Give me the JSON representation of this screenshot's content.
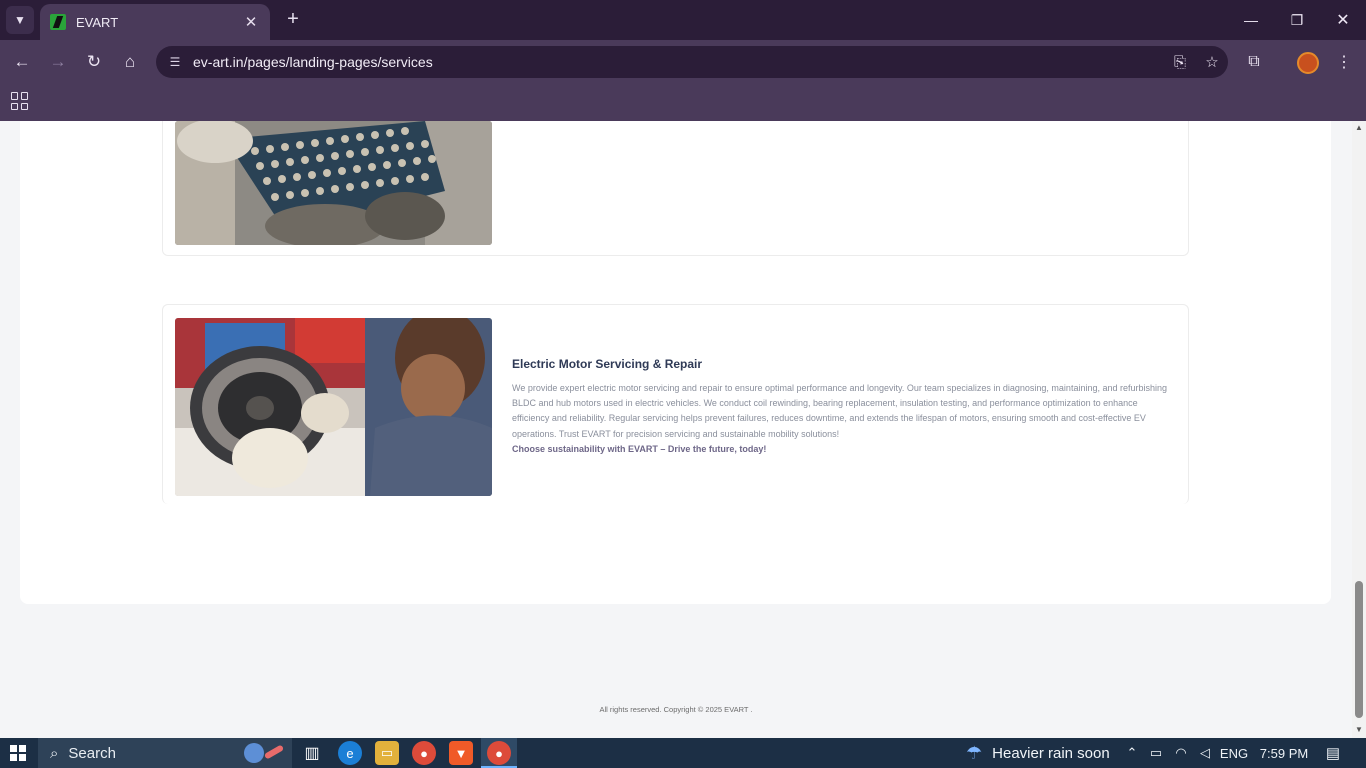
{
  "browser": {
    "tab_title": "EVART",
    "new_tab_label": "+",
    "url": "ev-art.in/pages/landing-pages/services",
    "icons": {
      "tab_search": "chevron-down-icon",
      "back": "back-arrow-icon",
      "forward": "forward-arrow-icon",
      "reload": "reload-icon",
      "home": "home-icon",
      "site_info": "site-info-icon",
      "install": "install-app-icon",
      "bookmark": "star-icon",
      "extensions": "puzzle-icon",
      "menu": "kebab-menu-icon",
      "apps": "apps-grid-icon"
    },
    "colors": {
      "frame": "#2b1d38",
      "toolbar": "#4a3a5a"
    }
  },
  "page": {
    "services": [
      {
        "image_alt": "Technician handling lithium battery cell pack",
        "title": "",
        "description": "",
        "cta": ""
      },
      {
        "image_alt": "Technician servicing electric hub motor stator",
        "title": "Electric Motor Servicing & Repair",
        "description": "We provide expert electric motor servicing and repair to ensure optimal performance and longevity. Our team specializes in diagnosing, maintaining, and refurbishing BLDC and hub motors used in electric vehicles. We conduct coil rewinding, bearing replacement, insulation testing, and performance optimization to enhance efficiency and reliability. Regular servicing helps prevent failures, reduces downtime, and extends the lifespan of motors, ensuring smooth and cost-effective EV operations. Trust EVART for precision servicing and sustainable mobility solutions!",
        "cta": "Choose sustainability with EVART – Drive the future, today!"
      }
    ],
    "footer": "All rights reserved. Copyright © 2025 EVART ."
  },
  "taskbar": {
    "search_label": "Search",
    "weather": "Heavier rain soon",
    "language": "ENG",
    "time": "7:59 PM",
    "icons": [
      "task-view-icon",
      "edge-icon",
      "file-explorer-icon",
      "chrome-icon",
      "brave-icon",
      "chrome-profile-icon"
    ]
  }
}
